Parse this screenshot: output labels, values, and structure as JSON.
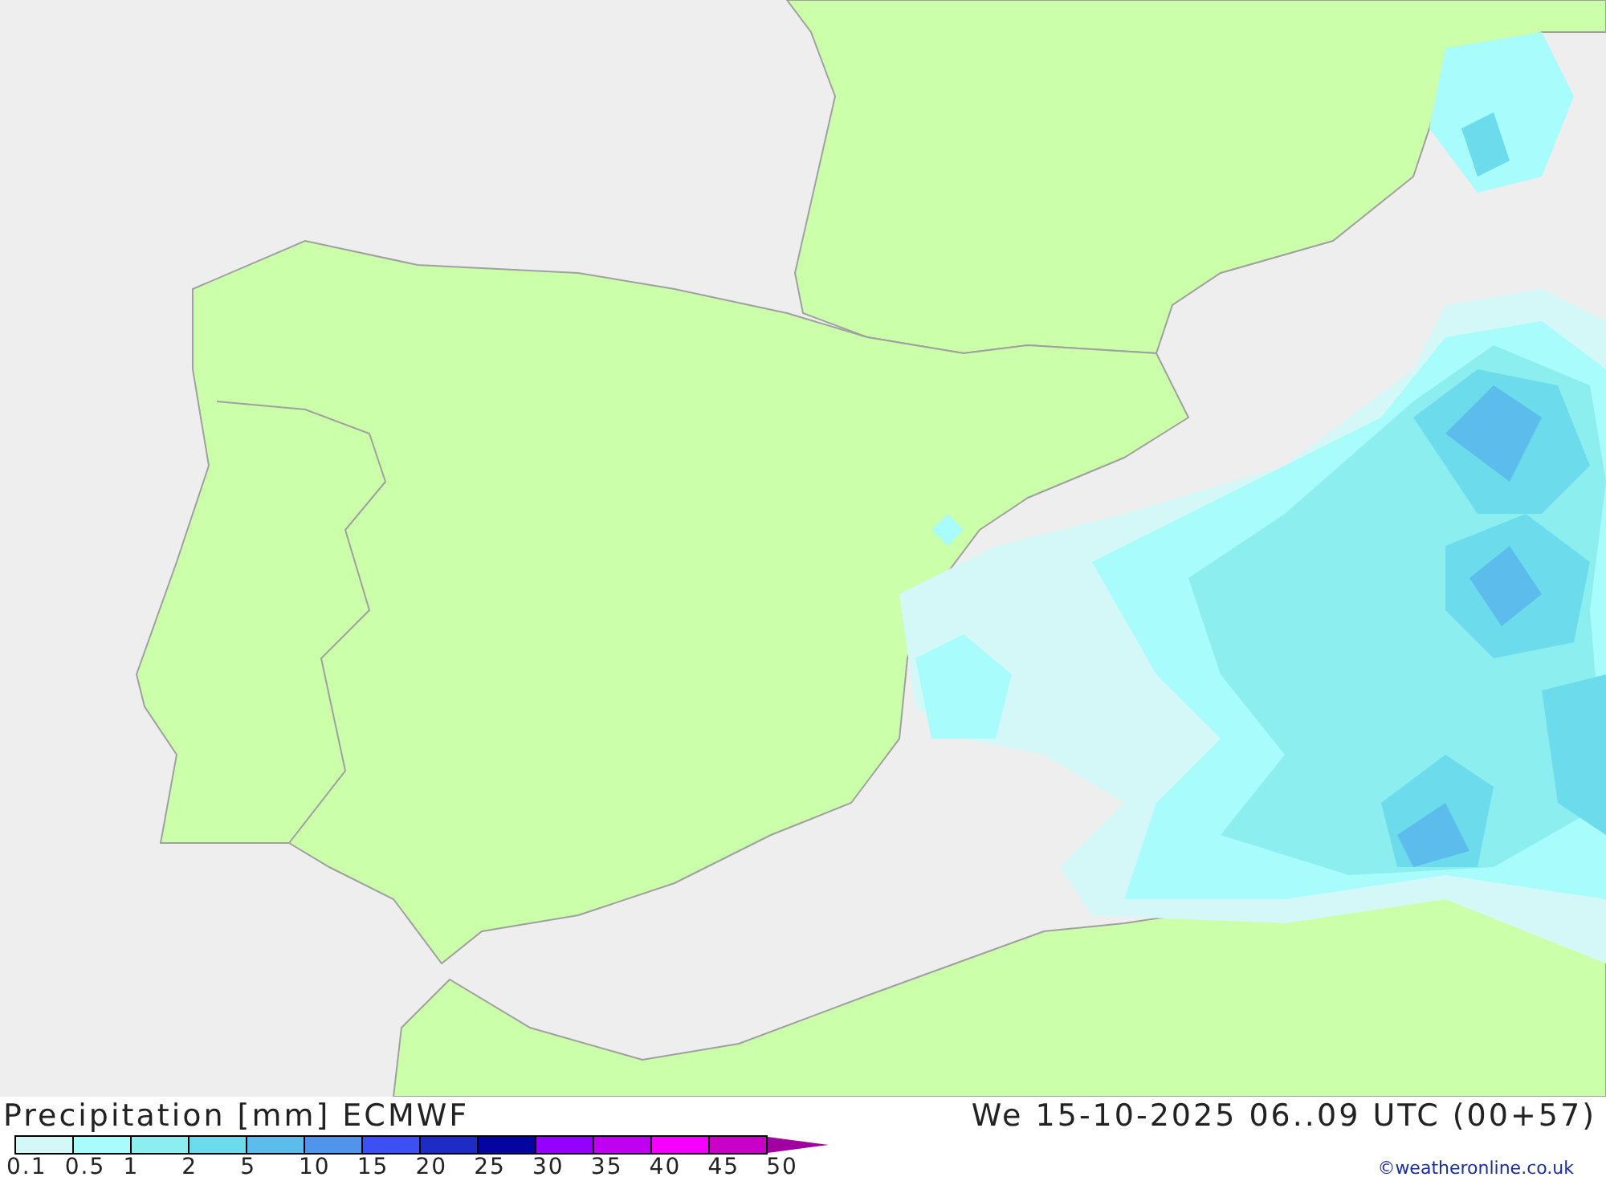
{
  "footer": {
    "title": "Precipitation [mm] ECMWF",
    "valid_time": "We 15-10-2025 06..09 UTC (00+57)",
    "credit": "©weatheronline.co.uk"
  },
  "legend": {
    "steps": [
      {
        "label": "0.1",
        "color": "#d4f8f8"
      },
      {
        "label": "0.5",
        "color": "#a8fcfc"
      },
      {
        "label": "1",
        "color": "#8ceeee"
      },
      {
        "label": "2",
        "color": "#6cdcec"
      },
      {
        "label": "5",
        "color": "#5cbcec"
      },
      {
        "label": "10",
        "color": "#5094ec"
      },
      {
        "label": "15",
        "color": "#3c50f4"
      },
      {
        "label": "20",
        "color": "#1c2cc4"
      },
      {
        "label": "25",
        "color": "#0404a0"
      },
      {
        "label": "30",
        "color": "#9400fc"
      },
      {
        "label": "35",
        "color": "#c000f0"
      },
      {
        "label": "40",
        "color": "#f400fc"
      },
      {
        "label": "45",
        "color": "#c800c8"
      },
      {
        "label": "50",
        "color": "#a000a0"
      }
    ]
  }
}
